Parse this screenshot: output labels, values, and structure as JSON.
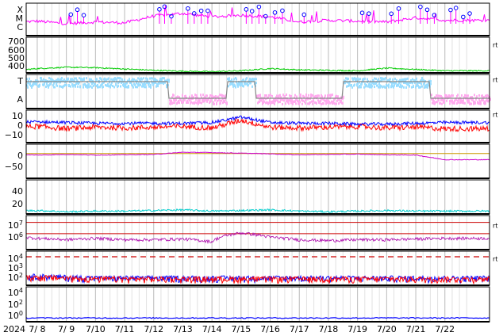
{
  "chart_data": {
    "type": "line",
    "x_tick_labels": [
      "2024",
      "7/ 8",
      "7/ 9",
      "7/10",
      "7/11",
      "7/12",
      "7/13",
      "7/14",
      "7/15",
      "7/16",
      "7/17",
      "7/18",
      "7/19",
      "7/20",
      "7/21",
      "7/22"
    ],
    "x_range": [
      "2024-07-07",
      "2024-07-22T23:59"
    ],
    "panels": [
      {
        "id": "flare-class",
        "y_tick_labels": [
          "X",
          "M",
          "C"
        ],
        "colors": {
          "flux": "#ff00ff",
          "events": "#0000ff"
        },
        "series": [
          {
            "values": [
              1.5,
              1.7,
              1.4,
              1.6,
              1.5,
              2.3,
              2.6,
              2.2,
              2.4,
              2.2,
              1.6,
              1.8,
              1.7,
              1.6,
              2.1,
              1.8
            ]
          }
        ],
        "events_per_day": [
          1,
          0,
          3,
          0,
          0,
          3,
          4,
          0,
          4,
          2,
          1,
          0,
          2,
          2,
          3,
          4
        ]
      },
      {
        "id": "solar-wind-speed",
        "y_tick_labels": [
          "700",
          "600",
          "500",
          "400"
        ],
        "ylim": [
          330,
          740
        ],
        "unit_label": "rt",
        "colors": {
          "speed": "#00cc00"
        },
        "series": [
          {
            "values": [
              350,
              380,
              395,
              390,
              375,
              360,
              350,
              345,
              355,
              380,
              365,
              360,
              355,
              385,
              370,
              355
            ]
          }
        ]
      },
      {
        "id": "sector",
        "y_tick_labels": [
          "T",
          "A"
        ],
        "unit_label": "rt",
        "colors": {
          "level": "#888888",
          "toward": "#99ddff",
          "away": "#ffaaee"
        },
        "series": [
          {
            "values": [
              1,
              1,
              1,
              1,
              1,
              1,
              0,
              0,
              1,
              0,
              0,
              0,
              1,
              1,
              1,
              0
            ]
          }
        ]
      },
      {
        "id": "imf",
        "y_tick_labels": [
          "10",
          "0",
          "−10"
        ],
        "ylim": [
          -20,
          22
        ],
        "unit_label": "rt",
        "colors": {
          "bt": "#0000ff",
          "bz": "#ff0000"
        },
        "series": [
          {
            "values": [
              6,
              7,
              6,
              5,
              5,
              5,
              5,
              6,
              13,
              6,
              5,
              5,
              4,
              4,
              5,
              6
            ]
          },
          {
            "values": [
              -1,
              1,
              -2,
              0,
              -1,
              0,
              1,
              -1,
              9,
              0,
              -1,
              0,
              1,
              -1,
              0,
              -2
            ]
          }
        ]
      },
      {
        "id": "dst",
        "y_tick_labels": [
          "0",
          "−50"
        ],
        "ylim": [
          -80,
          30
        ],
        "colors": {
          "index": "#cc00cc",
          "zero": "#cc9900"
        },
        "series": [
          {
            "values": [
              -2,
              -5,
              -3,
              -5,
              -4,
              -3,
              4,
              3,
              1,
              -1,
              -4,
              -3,
              -2,
              -4,
              -5,
              -20
            ]
          }
        ]
      },
      {
        "id": "density",
        "y_tick_labels": [
          "40",
          "20"
        ],
        "ylim": [
          0,
          55
        ],
        "colors": {
          "density": "#00cccc"
        },
        "series": [
          {
            "values": [
              4,
              5,
              3,
              4,
              4,
              5,
              6,
              4,
              5,
              6,
              4,
              3,
              4,
              5,
              4,
              4
            ]
          }
        ]
      },
      {
        "id": "electron-flux",
        "y_tick_labels": [
          "10^7",
          "10^6"
        ],
        "y_log": true,
        "unit_label": "rt",
        "colors": {
          "flux": "#aa00aa",
          "thresholds": "#cc0000"
        },
        "thresholds": [
          10000000,
          1000000
        ],
        "series": [
          {
            "values": [
              600000,
              400000,
              300000,
              400000,
              300000,
              300000,
              350000,
              200000,
              1200000,
              500000,
              300000,
              250000,
              300000,
              300000,
              350000,
              400000
            ]
          }
        ]
      },
      {
        "id": "proton-flux",
        "y_tick_labels": [
          "10^4",
          "10^3",
          "10^2"
        ],
        "y_log": true,
        "unit_label": "rt",
        "colors": {
          "low": "#0000ff",
          "high": "#ff0000",
          "threshold": "#cc0000"
        },
        "thresholds": [
          10000
        ],
        "series": [
          {
            "values": [
              50,
              80,
              60,
              50,
              50,
              50,
              50,
              50,
              50,
              50,
              50,
              50,
              50,
              50,
              50,
              50
            ]
          },
          {
            "values": [
              40,
              60,
              50,
              40,
              40,
              40,
              40,
              40,
              40,
              40,
              40,
              40,
              40,
              40,
              40,
              40
            ]
          }
        ]
      },
      {
        "id": "count",
        "y_tick_labels": [
          "10^4",
          "10^2",
          "10^0"
        ],
        "y_log": true,
        "colors": {
          "count": "#0000ff"
        },
        "series": [
          {
            "values": [
              1,
              1,
              1,
              1,
              1,
              1,
              1,
              1,
              1,
              1,
              1,
              1,
              1,
              1,
              1,
              1
            ]
          }
        ]
      }
    ]
  }
}
